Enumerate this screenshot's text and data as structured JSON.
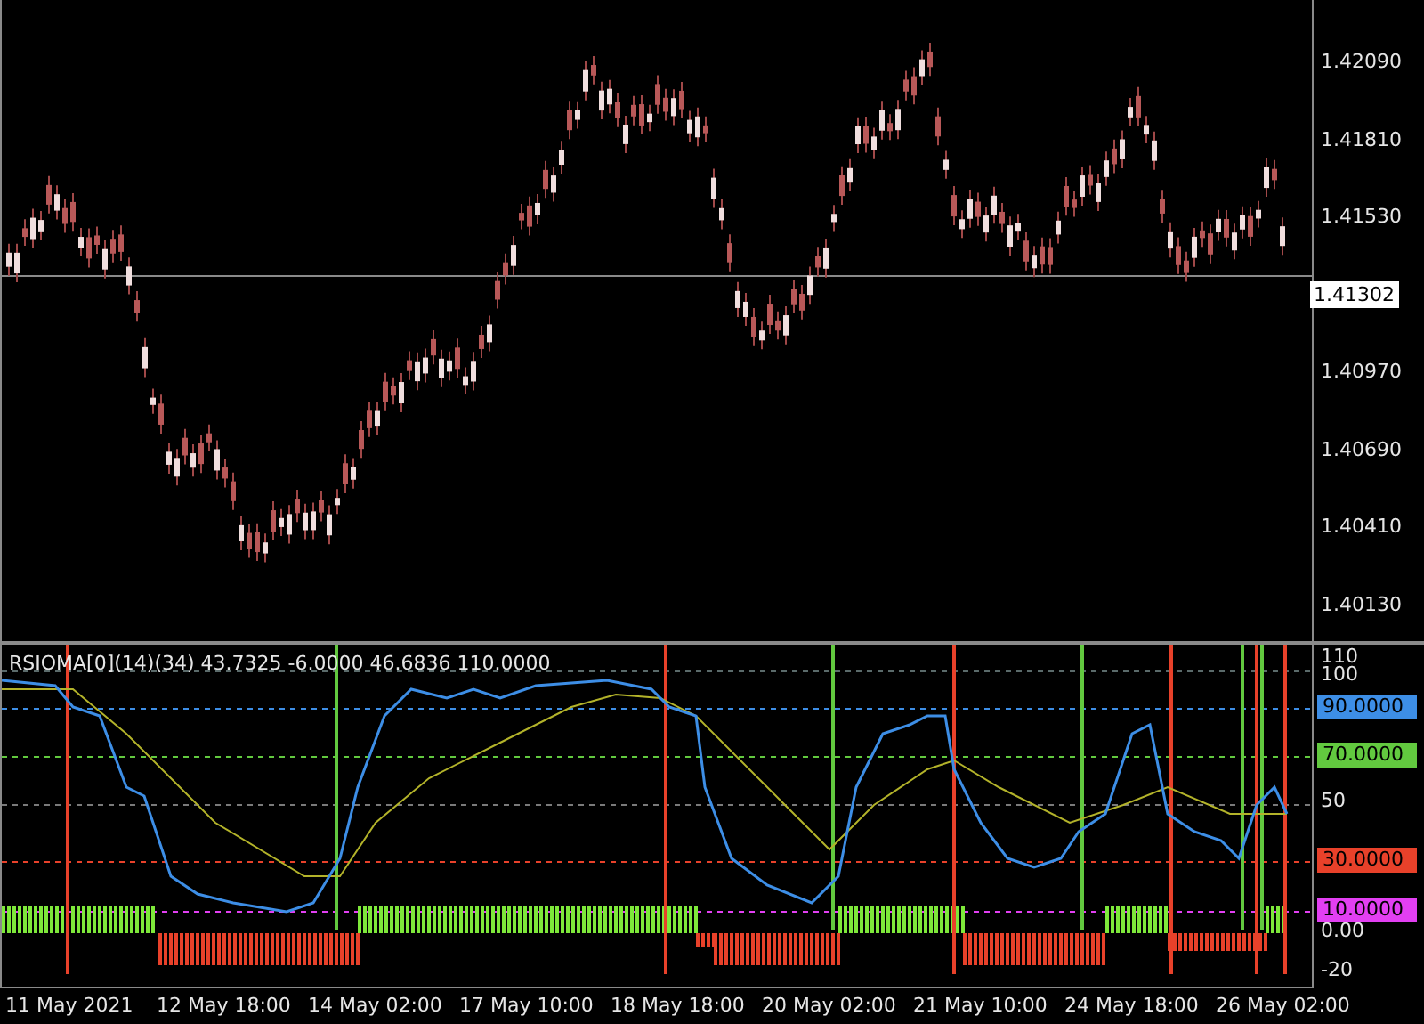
{
  "price_axis": [
    {
      "text": "1.42090",
      "kind": "tick"
    },
    {
      "text": "1.41810",
      "kind": "tick"
    },
    {
      "text": "1.41530",
      "kind": "tick"
    },
    {
      "text": "1.41302",
      "kind": "current"
    },
    {
      "text": "1.40970",
      "kind": "tick"
    },
    {
      "text": "1.40690",
      "kind": "tick"
    },
    {
      "text": "1.40410",
      "kind": "tick"
    },
    {
      "text": "1.40130",
      "kind": "tick"
    }
  ],
  "indicator": {
    "title": "RSIOMA[0](14)(34) 43.7325 -6.0000 46.6836 110.0000",
    "axis": [
      {
        "text": "110",
        "kind": "tick"
      },
      {
        "text": "100",
        "kind": "tick"
      },
      {
        "text": "90.0000",
        "kind": "level",
        "color": "#3d8ee6"
      },
      {
        "text": "70.0000",
        "kind": "level",
        "color": "#62c93f"
      },
      {
        "text": "50",
        "kind": "tick"
      },
      {
        "text": "30.0000",
        "kind": "level",
        "color": "#e8412a"
      },
      {
        "text": "10.0000",
        "kind": "level",
        "color": "#e23ff2"
      },
      {
        "text": "0.00",
        "kind": "tick"
      },
      {
        "text": "-20",
        "kind": "tick"
      }
    ]
  },
  "time_axis": [
    "11 May 2021",
    "12 May 18:00",
    "14 May 02:00",
    "17 May 10:00",
    "18 May 18:00",
    "20 May 02:00",
    "21 May 10:00",
    "24 May 18:00",
    "26 May 02:00"
  ]
}
